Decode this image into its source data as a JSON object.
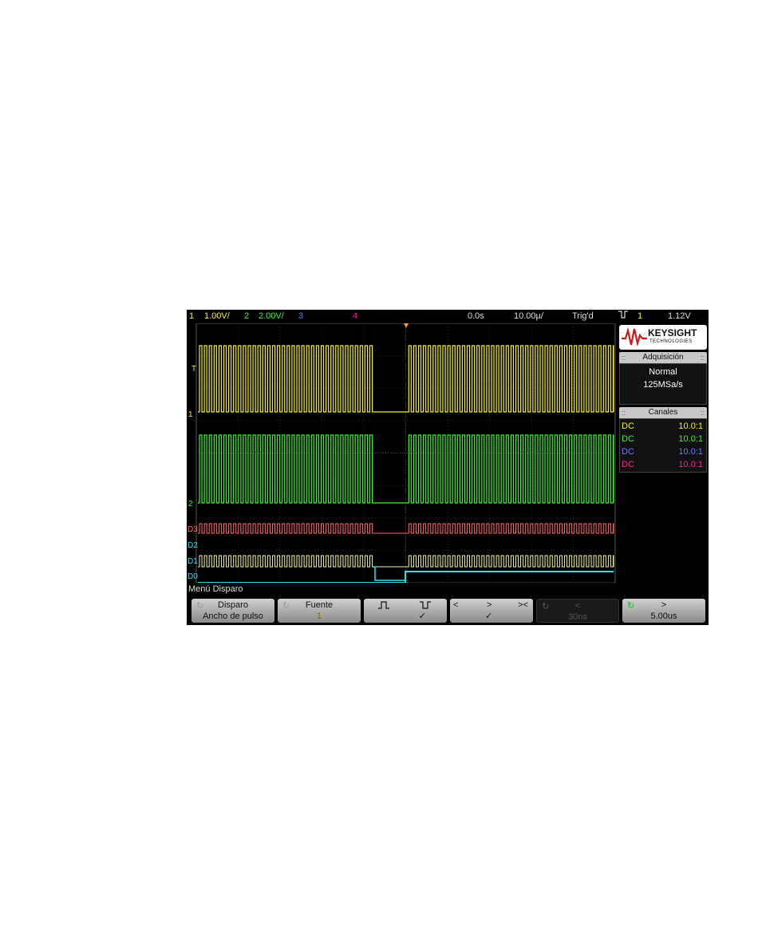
{
  "status_bar": {
    "ch1_num": "1",
    "ch1_scale": "1.00V/",
    "ch2_num": "2",
    "ch2_scale": "2.00V/",
    "ch3_num": "3",
    "ch4_num": "4",
    "time_delay": "0.0s",
    "time_scale": "10.00µ/",
    "trigger_state": "Trig'd",
    "trigger_source": "1",
    "trigger_level": "1.12V"
  },
  "logo": {
    "brand": "KEYSIGHT",
    "sub": "TECHNOLOGIES"
  },
  "acquisition": {
    "title": "Adquisición",
    "mode": "Normal",
    "rate": "125MSa/s"
  },
  "channels_panel": {
    "title": "Canales",
    "rows": [
      {
        "coupling": "DC",
        "probe": "10.0:1",
        "color": "#f7f01a"
      },
      {
        "coupling": "DC",
        "probe": "10.0:1",
        "color": "#44ee33"
      },
      {
        "coupling": "DC",
        "probe": "10.0:1",
        "color": "#6a7bff"
      },
      {
        "coupling": "DC",
        "probe": "10.0:1",
        "color": "#ff1f8f"
      }
    ]
  },
  "waveform_labels": {
    "trigger_marker": "T",
    "ch1": "1",
    "ch2": "2",
    "d3": "D3",
    "d2": "D2",
    "d1": "D1",
    "d0": "D0"
  },
  "menu_title": "Menú Disparo",
  "softkeys": [
    {
      "top": "Disparo",
      "bottom": "Ancho de pulso"
    },
    {
      "top": "Fuente",
      "bottom": "1"
    },
    {
      "top_left": "⎍",
      "top_right": "⎎",
      "bottom": "✓"
    },
    {
      "top_left": "<",
      "top_mid": ">",
      "top_right": "><",
      "bottom": "✓"
    },
    {
      "top": "<",
      "bottom": "30ns"
    },
    {
      "top": ">",
      "bottom": "5.00us"
    }
  ],
  "colors": {
    "ch1": "#f7f01a",
    "ch2": "#44ee33",
    "ch3": "#6a7bff",
    "ch4": "#ff1f8f",
    "d3": "#ff6b6b",
    "d2": "#33ddee",
    "d1_high": "#f4f4a0",
    "d0": "#33ddee",
    "trigger": "#ffa000"
  }
}
